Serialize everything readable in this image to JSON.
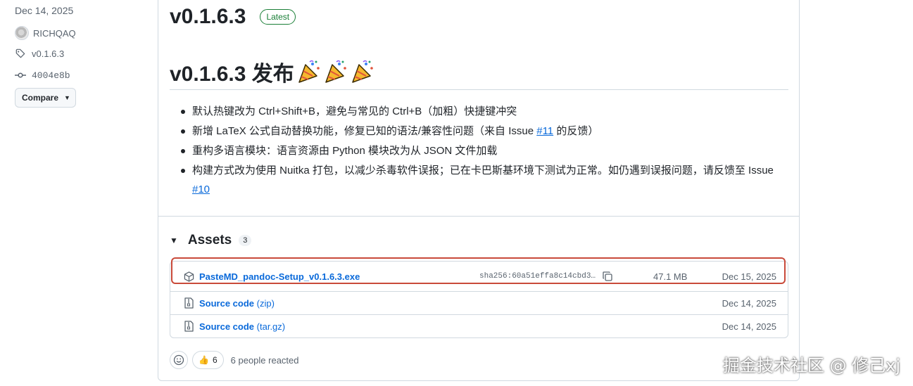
{
  "sidebar": {
    "date": "Dec 14, 2025",
    "author": "RICHQAQ",
    "tag": "v0.1.6.3",
    "commit": "4004e8b",
    "compare_label": "Compare"
  },
  "release": {
    "version": "v0.1.6.3",
    "latest_label": "Latest",
    "body_title": "v0.1.6.3 发布",
    "notes": [
      {
        "text": "默认热键改为 Ctrl+Shift+B，避免与常见的 Ctrl+B（加粗）快捷键冲突"
      },
      {
        "text_before": "新增 LaTeX 公式自动替换功能，修复已知的语法/兼容性问题（来自 Issue ",
        "link": "#11",
        "text_after": " 的反馈）"
      },
      {
        "text": "重构多语言模块：语言资源由 Python 模块改为从 JSON 文件加载"
      },
      {
        "text_before": "构建方式改为使用 Nuitka 打包，以减少杀毒软件误报；已在卡巴斯基环境下测试为正常。如仍遇到误报问题，请反馈至 Issue ",
        "link": "#10",
        "text_after": ""
      }
    ]
  },
  "assets": {
    "title": "Assets",
    "count": "3",
    "items": [
      {
        "name": "PasteMD_pandoc-Setup_v0.1.6.3.exe",
        "sha": "sha256:60a51effa8c14cbd3…",
        "size": "47.1 MB",
        "date": "Dec 15, 2025"
      },
      {
        "name": "Source code",
        "suffix": "(zip)",
        "date": "Dec 14, 2025"
      },
      {
        "name": "Source code",
        "suffix": "(tar.gz)",
        "date": "Dec 14, 2025"
      }
    ]
  },
  "reactions": {
    "thumbs_count": "6",
    "summary": "6 people reacted"
  },
  "watermark": "掘金技术社区 @ 修己xj",
  "colors": {
    "link": "#0969da",
    "latest_green": "#1a7f37",
    "highlight_red": "#c94a3a"
  }
}
